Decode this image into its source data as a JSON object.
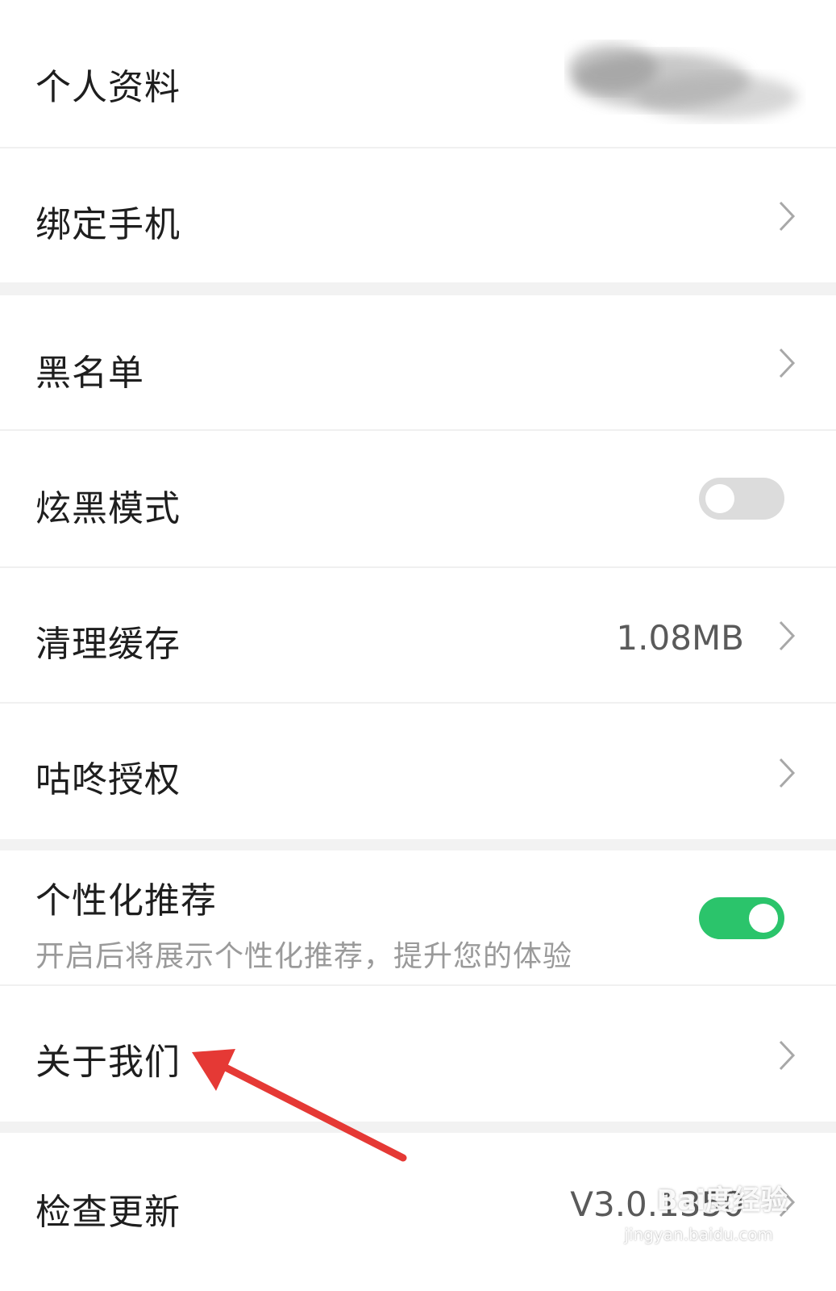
{
  "rows": {
    "profile": {
      "label": "个人资料"
    },
    "bind_phone": {
      "label": "绑定手机"
    },
    "blacklist": {
      "label": "黑名单"
    },
    "dark_mode": {
      "label": "炫黑模式",
      "enabled": false
    },
    "clear_cache": {
      "label": "清理缓存",
      "value": "1.08MB"
    },
    "gudong_auth": {
      "label": "咕咚授权"
    },
    "personalized": {
      "label": "个性化推荐",
      "description": "开启后将展示个性化推荐，提升您的体验",
      "enabled": true
    },
    "about_us": {
      "label": "关于我们"
    },
    "check_update": {
      "label": "检查更新",
      "value": "V3.0.1350"
    }
  },
  "watermark": {
    "brand": "Bai度经验",
    "url": "jingyan.baidu.com"
  },
  "colors": {
    "toggle_on": "#2bc46b",
    "toggle_off": "#dcdcdc",
    "annotation_arrow": "#e53935"
  },
  "icons": {
    "chevron": "chevron-right-icon"
  }
}
